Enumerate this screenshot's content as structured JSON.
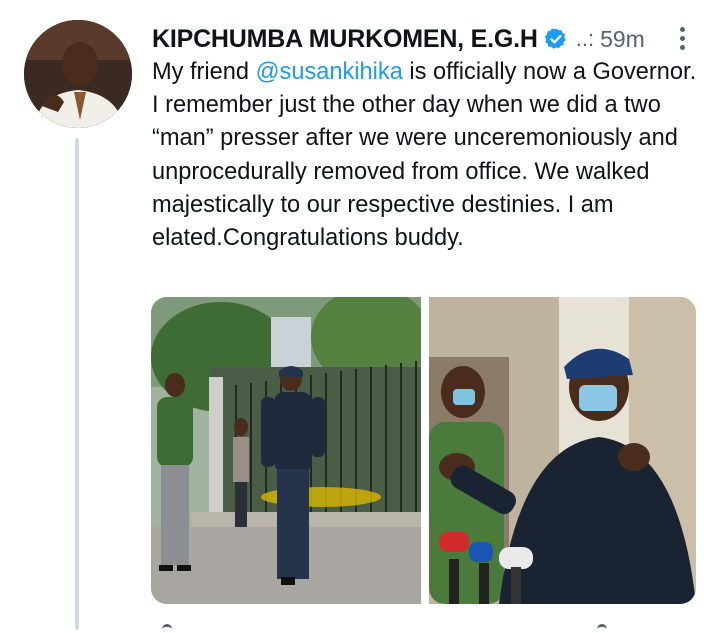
{
  "tweet": {
    "author_name": "KIPCHUMBA MURKOMEN, E.G.H",
    "handle": "..:",
    "time": "59m",
    "text_before_mention": "My friend ",
    "mention": "@susankihika",
    "text_after_mention": " is officially now a Governor. I remember just the other day when we did a two “man” presser after we were unceremoniously and unprocedurally  removed from office. We walked majestically to our respective destinies. I am elated.Congratulations buddy."
  },
  "icons": {
    "verified": "verified-badge-icon",
    "more": "more-options-icon"
  },
  "colors": {
    "link": "#1d9bf0",
    "verified": "#1d9bf0",
    "secondary_text": "#536471",
    "thread_line": "#cfd9de"
  },
  "media": {
    "count": 2
  }
}
